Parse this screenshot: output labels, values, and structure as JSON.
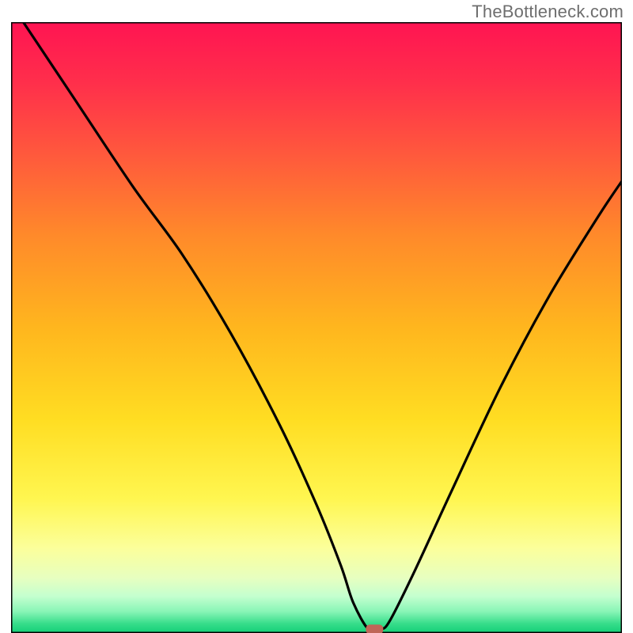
{
  "watermark": "TheBottleneck.com",
  "chart_data": {
    "type": "line",
    "title": "",
    "xlabel": "",
    "ylabel": "",
    "xlim": [
      0,
      100
    ],
    "ylim": [
      0,
      100
    ],
    "series": [
      {
        "name": "curve",
        "x": [
          2,
          10,
          20,
          28,
          36,
          44,
          50,
          54,
          56,
          58.5,
          60.5,
          62,
          66,
          72,
          80,
          88,
          96,
          100
        ],
        "values": [
          100,
          88,
          73,
          62,
          49,
          34,
          21,
          11,
          5,
          0.6,
          0.6,
          2,
          10,
          23,
          40,
          55,
          68,
          74
        ]
      }
    ],
    "marker": {
      "name": "marker-point",
      "x": 59.5,
      "y": 0.6,
      "color": "#c06658"
    },
    "background": {
      "type": "vertical-gradient",
      "stops": [
        {
          "offset": 0.0,
          "color": "#ff1452"
        },
        {
          "offset": 0.1,
          "color": "#ff2f4b"
        },
        {
          "offset": 0.22,
          "color": "#ff5a3c"
        },
        {
          "offset": 0.35,
          "color": "#ff8a2a"
        },
        {
          "offset": 0.5,
          "color": "#ffb61e"
        },
        {
          "offset": 0.65,
          "color": "#ffdd22"
        },
        {
          "offset": 0.78,
          "color": "#fff650"
        },
        {
          "offset": 0.86,
          "color": "#fcff9a"
        },
        {
          "offset": 0.91,
          "color": "#e7ffc0"
        },
        {
          "offset": 0.94,
          "color": "#c4ffcf"
        },
        {
          "offset": 0.965,
          "color": "#88f5b6"
        },
        {
          "offset": 0.985,
          "color": "#36dd8a"
        },
        {
          "offset": 1.0,
          "color": "#14cf78"
        }
      ]
    }
  }
}
